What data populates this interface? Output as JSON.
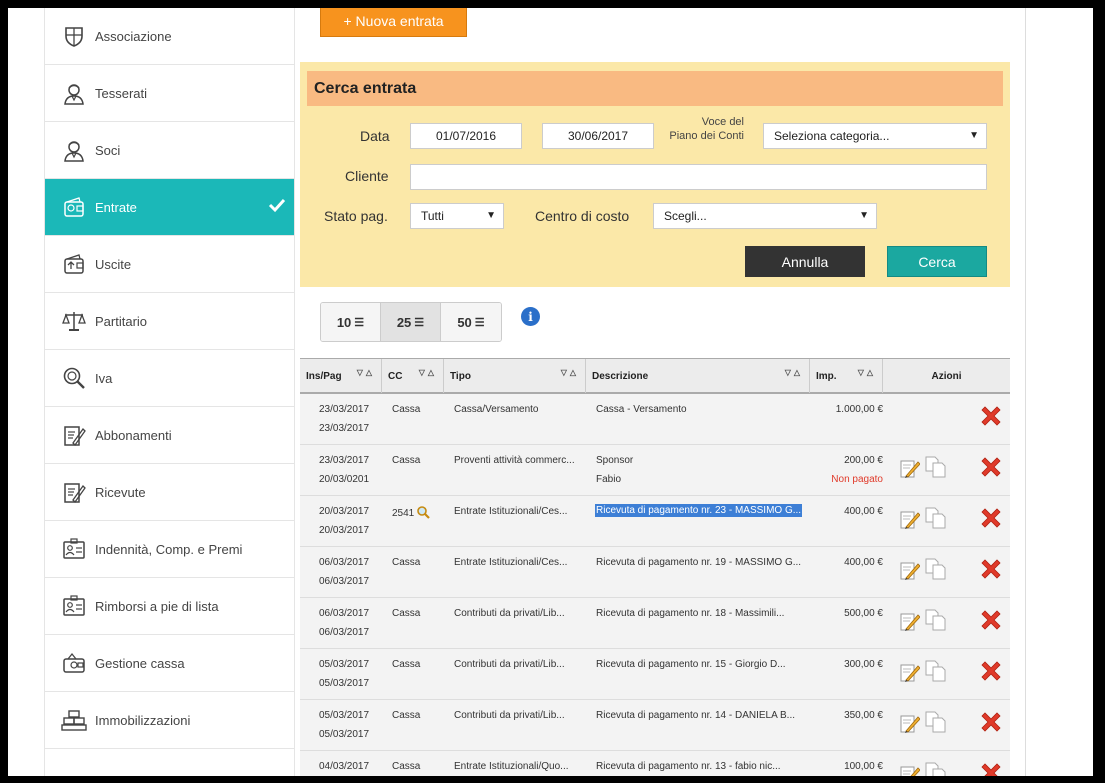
{
  "sidebar": {
    "items": [
      {
        "label": "Associazione",
        "icon": "shield-icon"
      },
      {
        "label": "Tesserati",
        "icon": "person-icon"
      },
      {
        "label": "Soci",
        "icon": "person-icon"
      },
      {
        "label": "Entrate",
        "icon": "wallet-in-icon",
        "active": true
      },
      {
        "label": "Uscite",
        "icon": "wallet-out-icon"
      },
      {
        "label": "Partitario",
        "icon": "scales-icon"
      },
      {
        "label": "Iva",
        "icon": "magnifier-coin-icon"
      },
      {
        "label": "Abbonamenti",
        "icon": "document-pen-icon"
      },
      {
        "label": "Ricevute",
        "icon": "document-pen-icon"
      },
      {
        "label": "Indennità, Comp. e Premi",
        "icon": "id-card-icon"
      },
      {
        "label": "Rimborsi a pie di lista",
        "icon": "id-card-icon"
      },
      {
        "label": "Gestione cassa",
        "icon": "cash-box-icon"
      },
      {
        "label": "Immobilizzazioni",
        "icon": "bricks-icon"
      }
    ]
  },
  "toolbar": {
    "new_entry_label": "+ Nuova entrata"
  },
  "search": {
    "title": "Cerca entrata",
    "data_label": "Data",
    "date_from": "01/07/2016",
    "date_to": "30/06/2017",
    "voce_label_1": "Voce del",
    "voce_label_2": "Piano dei Conti",
    "category_value": "Seleziona categoria...",
    "cliente_label": "Cliente",
    "cliente_value": "",
    "stato_label": "Stato pag.",
    "stato_value": "Tutti",
    "centro_label": "Centro di costo",
    "centro_value": "Scegli...",
    "annulla_label": "Annulla",
    "cerca_label": "Cerca"
  },
  "page_sizes": [
    {
      "label": "10",
      "selected": false
    },
    {
      "label": "25",
      "selected": true
    },
    {
      "label": "50",
      "selected": false
    }
  ],
  "info_label": "i",
  "table": {
    "headers": {
      "ins_pag": "Ins/Pag",
      "cc": "CC",
      "tipo": "Tipo",
      "descrizione": "Descrizione",
      "imp": "Imp.",
      "azioni": "Azioni"
    },
    "rows": [
      {
        "ins": "23/03/2017",
        "pag": "23/03/2017",
        "cc": "Cassa",
        "tipo": "Cassa/Versamento",
        "desc": "Cassa - Versamento",
        "desc2": "",
        "imp": "1.000,00 €",
        "status": "",
        "editable": false
      },
      {
        "ins": "23/03/2017",
        "pag": "20/03/0201",
        "cc": "Cassa",
        "tipo": "Proventi attività commerc...",
        "desc": "Sponsor",
        "desc2": "Fabio",
        "imp": "200,00 €",
        "status": "Non pagato",
        "editable": true
      },
      {
        "ins": "20/03/2017",
        "pag": "20/03/2017",
        "cc": "2541",
        "tipo": "Entrate Istituzionali/Ces...",
        "desc": "Ricevuta di pagamento nr. 23 - MASSIMO G...",
        "desc2": "",
        "imp": "400,00 €",
        "status": "",
        "editable": true,
        "selected": true
      },
      {
        "ins": "06/03/2017",
        "pag": "06/03/2017",
        "cc": "Cassa",
        "tipo": "Entrate Istituzionali/Ces...",
        "desc": "Ricevuta di pagamento nr. 19 - MASSIMO G...",
        "desc2": "",
        "imp": "400,00 €",
        "status": "",
        "editable": true
      },
      {
        "ins": "06/03/2017",
        "pag": "06/03/2017",
        "cc": "Cassa",
        "tipo": "Contributi da privati/Lib...",
        "desc": "Ricevuta di pagamento nr. 18 - Massimili...",
        "desc2": "",
        "imp": "500,00 €",
        "status": "",
        "editable": true
      },
      {
        "ins": "05/03/2017",
        "pag": "05/03/2017",
        "cc": "Cassa",
        "tipo": "Contributi da privati/Lib...",
        "desc": "Ricevuta di pagamento nr. 15 - Giorgio D...",
        "desc2": "",
        "imp": "300,00 €",
        "status": "",
        "editable": true
      },
      {
        "ins": "05/03/2017",
        "pag": "05/03/2017",
        "cc": "Cassa",
        "tipo": "Contributi da privati/Lib...",
        "desc": "Ricevuta di pagamento nr. 14 - DANIELA B...",
        "desc2": "",
        "imp": "350,00 €",
        "status": "",
        "editable": true
      },
      {
        "ins": "04/03/2017",
        "pag": "",
        "cc": "Cassa",
        "tipo": "Entrate Istituzionali/Quo...",
        "desc": "Ricevuta di pagamento nr. 13 - fabio nic...",
        "desc2": "",
        "imp": "100,00 €",
        "status": "",
        "editable": true
      }
    ]
  },
  "colors": {
    "accent_teal": "#1bb8b8",
    "new_button_orange": "#f7931e",
    "search_bg": "#fbe8a8",
    "search_header": "#f9ba82",
    "delete_red": "#e03a2a"
  }
}
